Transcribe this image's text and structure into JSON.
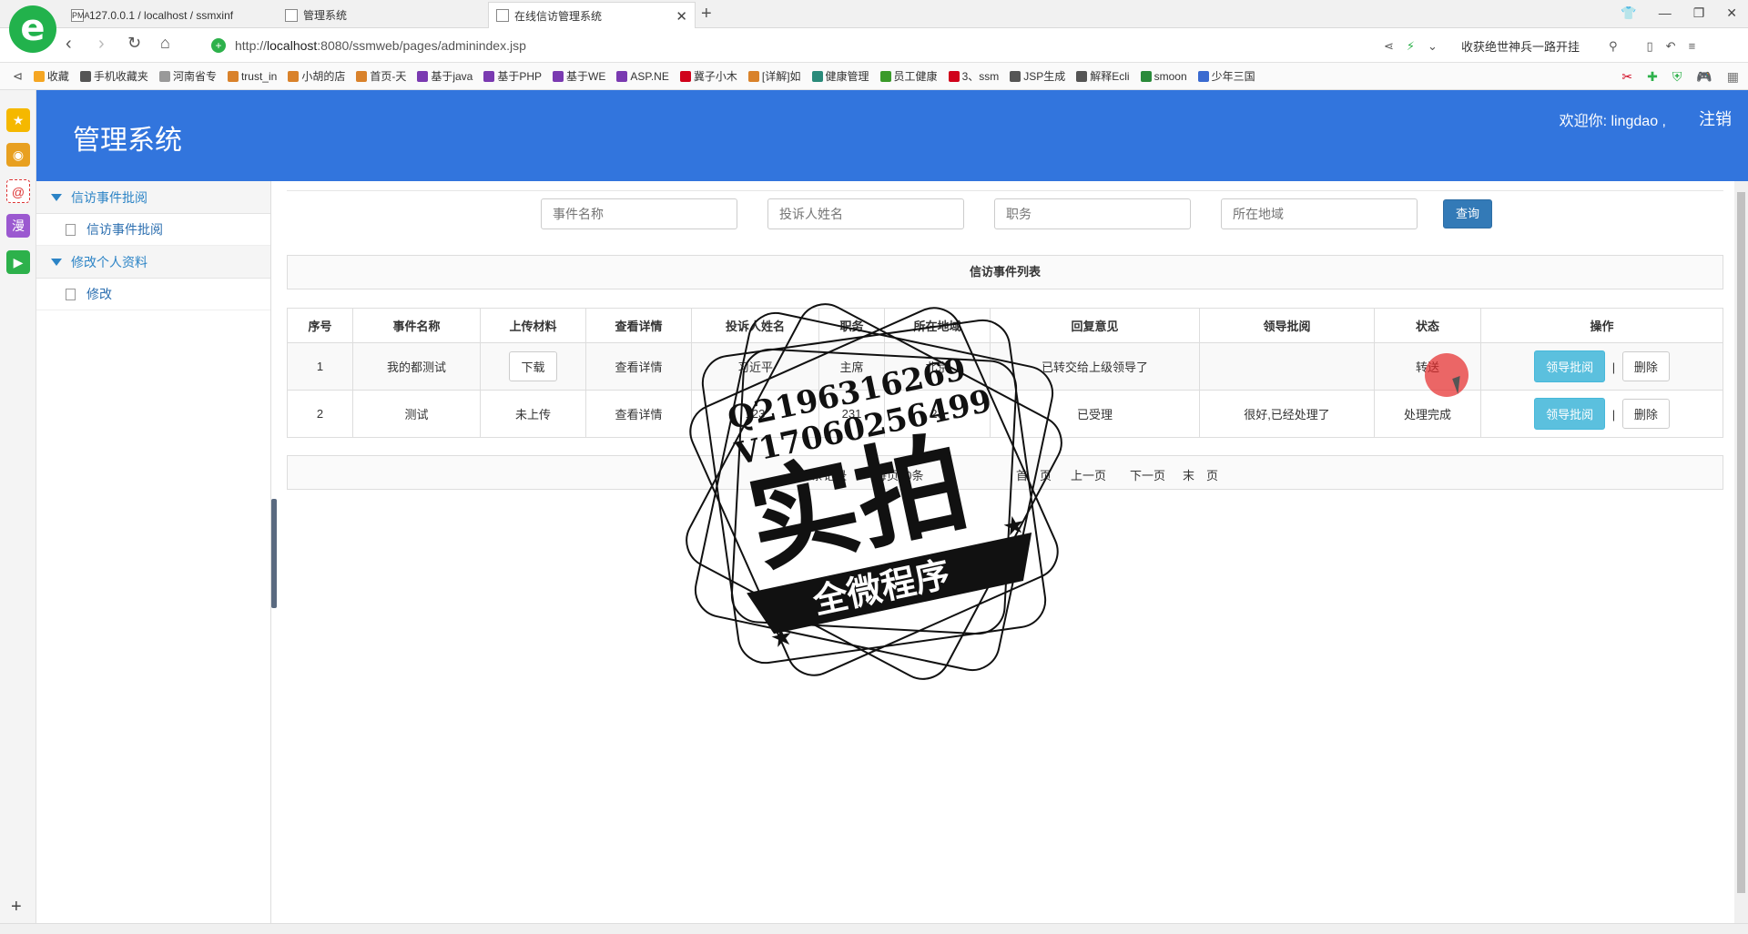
{
  "browser": {
    "tabs": [
      {
        "label": "127.0.0.1 / localhost / ssmxinf",
        "favicon": "PMA"
      },
      {
        "label": "管理系统",
        "favicon": ""
      },
      {
        "label": "在线信访管理系统",
        "favicon": ""
      }
    ],
    "url_prefix": "http://",
    "url_host": "localhost",
    "url_rest": ":8080/ssmweb/pages/adminindex.jsp",
    "news_text": "收获绝世神兵一路开挂",
    "bookmarks": [
      {
        "label": "收藏",
        "color": "#f5a623"
      },
      {
        "label": "手机收藏夹",
        "color": "#555555"
      },
      {
        "label": "河南省专",
        "color": "#999999"
      },
      {
        "label": "trust_in",
        "color": "#d9822b"
      },
      {
        "label": "小胡的店",
        "color": "#d9822b"
      },
      {
        "label": "首页-天",
        "color": "#d9822b"
      },
      {
        "label": "基于java",
        "color": "#7a3ab1"
      },
      {
        "label": "基于PHP",
        "color": "#7a3ab1"
      },
      {
        "label": "基于WE",
        "color": "#7a3ab1"
      },
      {
        "label": "ASP.NE",
        "color": "#7a3ab1"
      },
      {
        "label": "冀子小木",
        "color": "#d0021b"
      },
      {
        "label": "[详解]如",
        "color": "#d9822b"
      },
      {
        "label": "健康管理",
        "color": "#2a8a7a"
      },
      {
        "label": "员工健康",
        "color": "#3a9a2a"
      },
      {
        "label": "3、ssm",
        "color": "#d0021b"
      },
      {
        "label": "JSP生成",
        "color": "#555555"
      },
      {
        "label": "解释Ecli",
        "color": "#555555"
      },
      {
        "label": "smoon",
        "color": "#2a8a3a"
      },
      {
        "label": "少年三国",
        "color": "#3a6ad0"
      }
    ]
  },
  "header": {
    "title": "管理系统",
    "welcome": "欢迎你: lingdao ,",
    "logout": "注销"
  },
  "sidebar": {
    "groups": [
      {
        "label": "信访事件批阅",
        "items": [
          {
            "label": "信访事件批阅"
          }
        ]
      },
      {
        "label": "修改个人资料",
        "items": [
          {
            "label": "修改"
          }
        ]
      }
    ]
  },
  "search": {
    "event_name_placeholder": "事件名称",
    "complainant_placeholder": "投诉人姓名",
    "position_placeholder": "职务",
    "region_placeholder": "所在地域",
    "button": "查询"
  },
  "list": {
    "title": "信访事件列表",
    "columns": [
      "序号",
      "事件名称",
      "上传材料",
      "查看详情",
      "投诉人姓名",
      "职务",
      "所在地域",
      "回复意见",
      "领导批阅",
      "状态",
      "操作"
    ],
    "rows": [
      {
        "no": "1",
        "name": "我的都测试",
        "material": "下载",
        "detail": "查看详情",
        "complainant": "习近平",
        "position": "主席",
        "region": "北京",
        "reply": "已转交给上级领导了",
        "review": "",
        "status": "转送",
        "action_review": "领导批阅",
        "action_sep": "|",
        "action_delete": "删除"
      },
      {
        "no": "2",
        "name": "测试",
        "material": "未上传",
        "detail": "查看详情",
        "complainant": "123",
        "position": "231",
        "region": "23",
        "reply": "已受理",
        "review": "很好,已经处理了",
        "status": "处理完成",
        "action_review": "领导批阅",
        "action_sep": "|",
        "action_delete": "删除"
      }
    ]
  },
  "pager": {
    "records": "共2条记录",
    "per_page": "每页10条",
    "first": "首　页",
    "prev": "上一页",
    "next": "下一页",
    "last": "末　页"
  },
  "watermark": {
    "qq": "Q2196316269",
    "v": "V17060256499",
    "main": "实拍",
    "banner": "全微程序"
  }
}
